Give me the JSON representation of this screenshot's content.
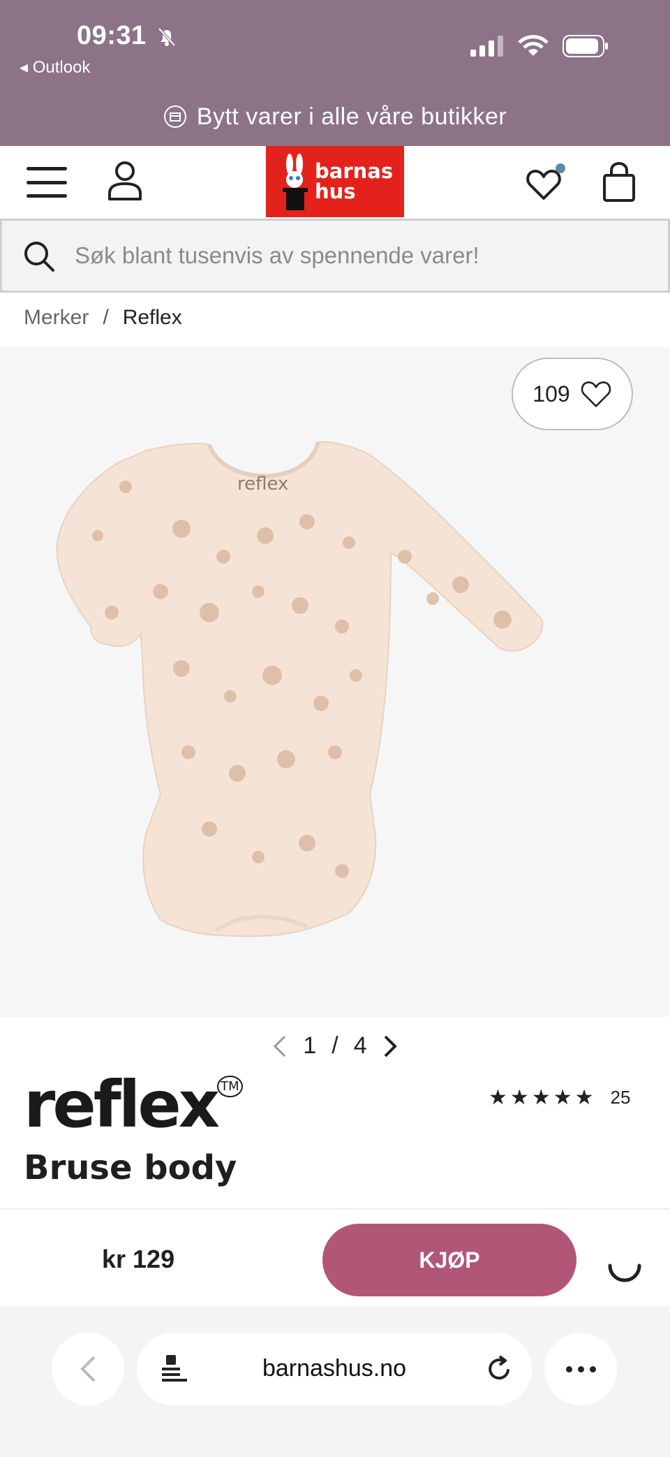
{
  "status_bar": {
    "time": "09:31",
    "back_app": "◂ Outlook"
  },
  "promo": {
    "text": "Bytt varer i alle våre butikker"
  },
  "header": {
    "logo_line1": "barnas",
    "logo_line2": "hus"
  },
  "search": {
    "placeholder": "Søk blant tusenvis av spennende varer!"
  },
  "breadcrumb": {
    "items": [
      "Merker",
      "Reflex"
    ],
    "separator": "/"
  },
  "gallery": {
    "likes": "109",
    "current": "1",
    "total": "4",
    "separator": "/"
  },
  "product": {
    "brand": "reflex",
    "trademark": "TM",
    "title": "Bruse body",
    "rating_count": "25",
    "rating_stars": 5,
    "price": "kr 129",
    "buy_label": "KJØP"
  },
  "browser": {
    "url": "barnashus.no"
  },
  "colors": {
    "topbar": "#8c7388",
    "logo_bg": "#e3231b",
    "buy_button": "#b15676",
    "accent_dot": "#5f87a6"
  }
}
